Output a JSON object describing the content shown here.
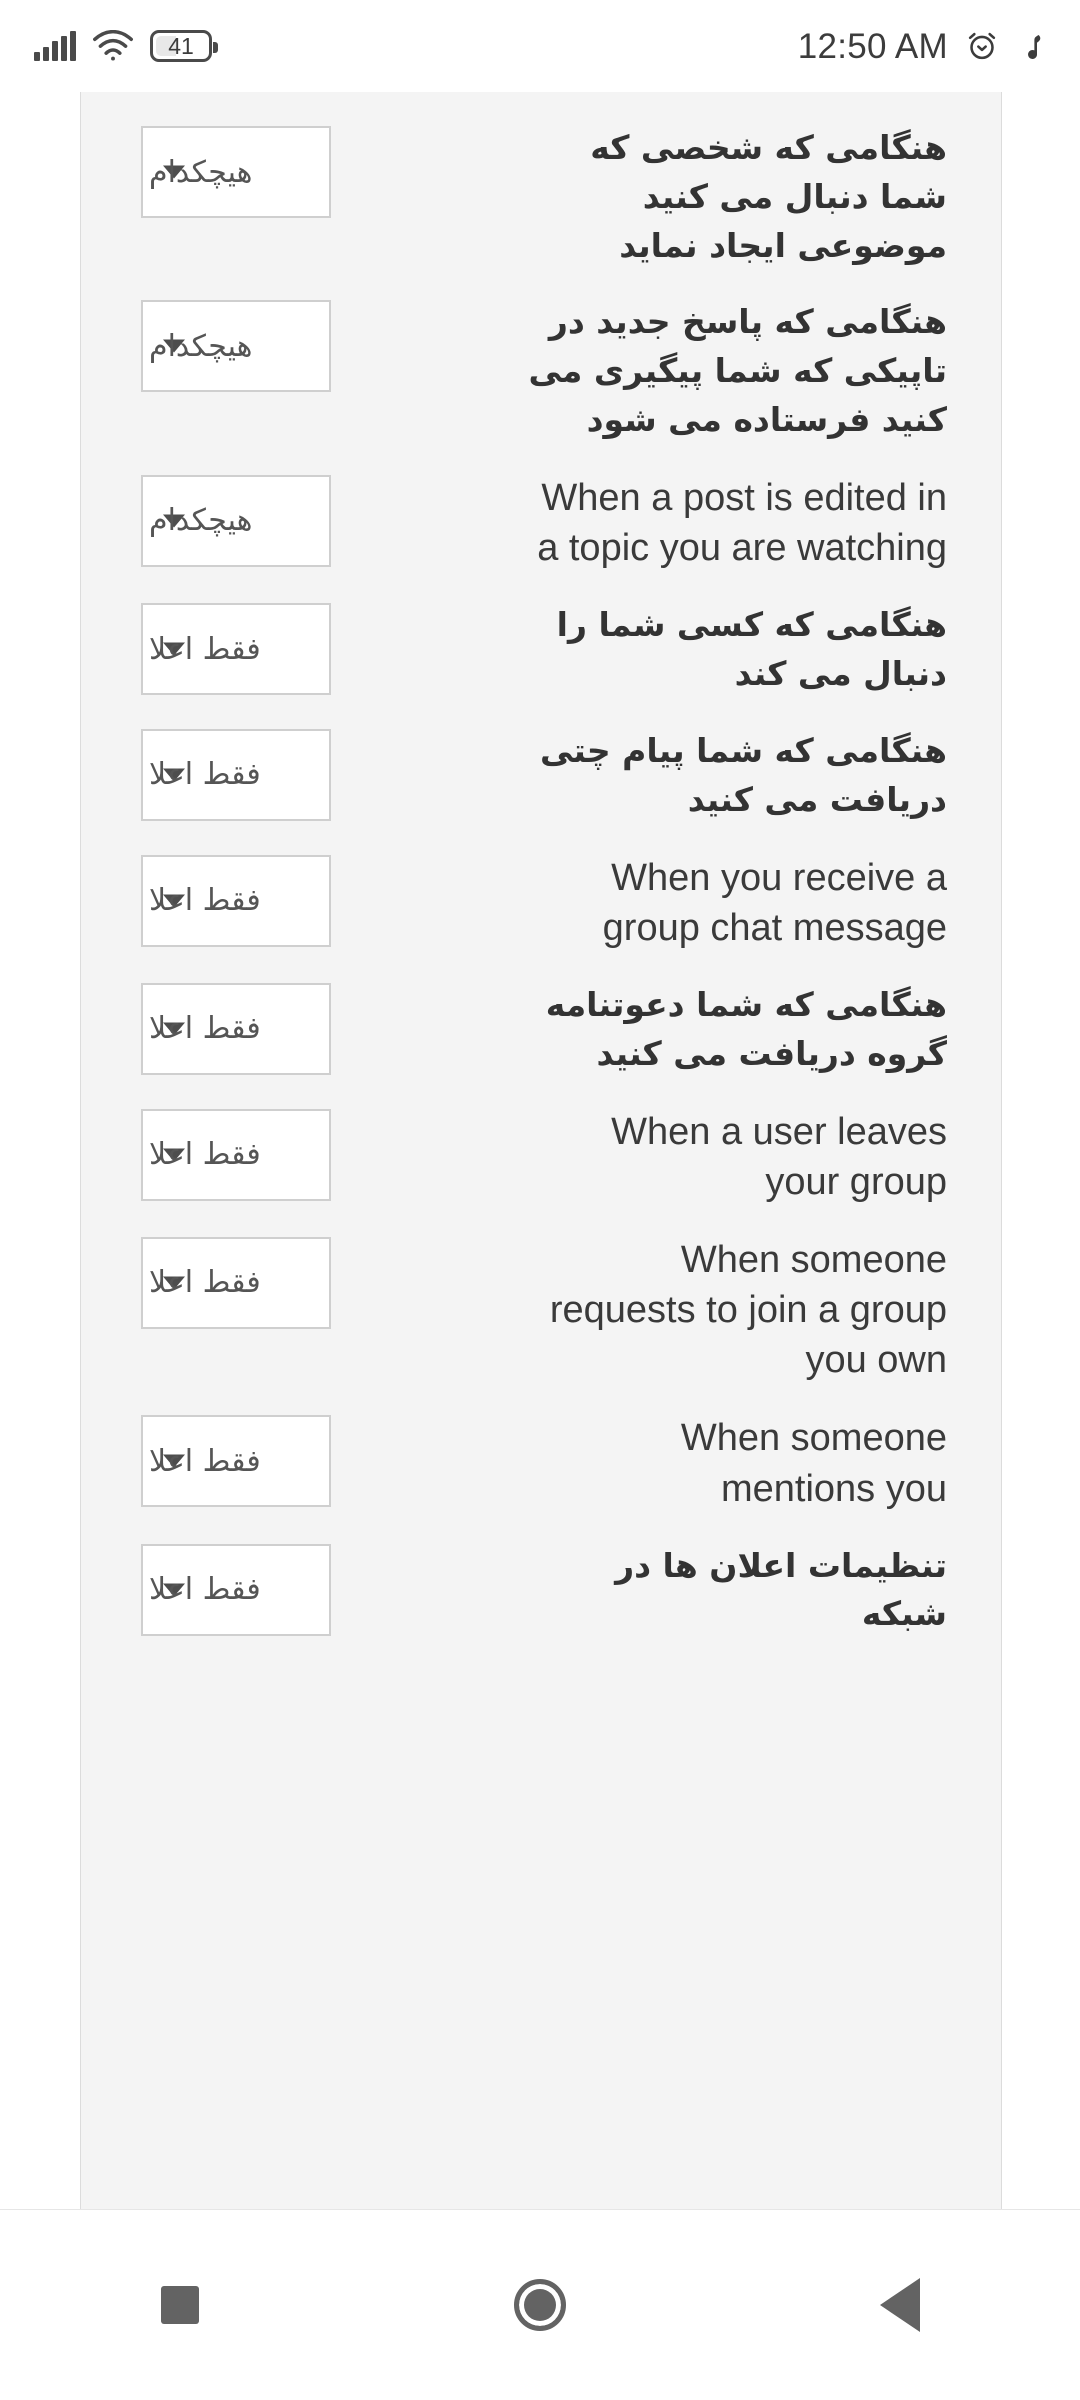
{
  "status_bar": {
    "time": "12:50 AM",
    "alarm_icon": "alarm-clock-icon",
    "music_icon": "music-note-icon",
    "signal_icon": "cellular-signal-icon",
    "wifi_icon": "wifi-icon",
    "battery_level": "41",
    "battery_icon": "battery-icon"
  },
  "colors": {
    "page_background": "#ffffff",
    "card_background": "#f4f4f4",
    "text": "#333333",
    "select_border": "#cfcfcf",
    "select_background": "#ffffff",
    "nav_icon": "#636363"
  },
  "preferences": {
    "rows": [
      {
        "label": "هنگامی که شخصی که شما دنبال می کنید موضوعی ایجاد نماید",
        "dir": "rtl",
        "value": "هیچکدام"
      },
      {
        "label": "هنگامی که پاسخ جدید در تاپیکی که شما پیگیری می کنید فرستاده می شود",
        "dir": "rtl",
        "value": "هیچکدام"
      },
      {
        "label": "When a post is edited in a topic you are watching",
        "dir": "ltr",
        "value": "هیچکدام"
      },
      {
        "label": "هنگامی که کسی شما را دنبال می کند",
        "dir": "rtl",
        "value": "فقط اعلا"
      },
      {
        "label": "هنگامی که شما پیام چتی دریافت می کنید",
        "dir": "rtl",
        "value": "فقط اعلا"
      },
      {
        "label": "When you receive a group chat message",
        "dir": "ltr",
        "value": "فقط اعلا"
      },
      {
        "label": "هنگامی که شما دعوتنامه گروه دریافت می کنید",
        "dir": "rtl",
        "value": "فقط اعلا"
      },
      {
        "label": "When a user leaves your group",
        "dir": "ltr",
        "value": "فقط اعلا"
      },
      {
        "label": "When someone requests to join a group you own",
        "dir": "ltr",
        "value": "فقط اعلا"
      },
      {
        "label": "When someone mentions you",
        "dir": "ltr",
        "value": "فقط اعلا"
      },
      {
        "label": "تنظیمات اعلان ها در شبکه",
        "dir": "rtl",
        "value": "فقط اعلا"
      }
    ]
  },
  "nav_bar": {
    "recents_label": "recents-square-icon",
    "home_label": "home-circle-icon",
    "back_label": "back-triangle-icon"
  }
}
